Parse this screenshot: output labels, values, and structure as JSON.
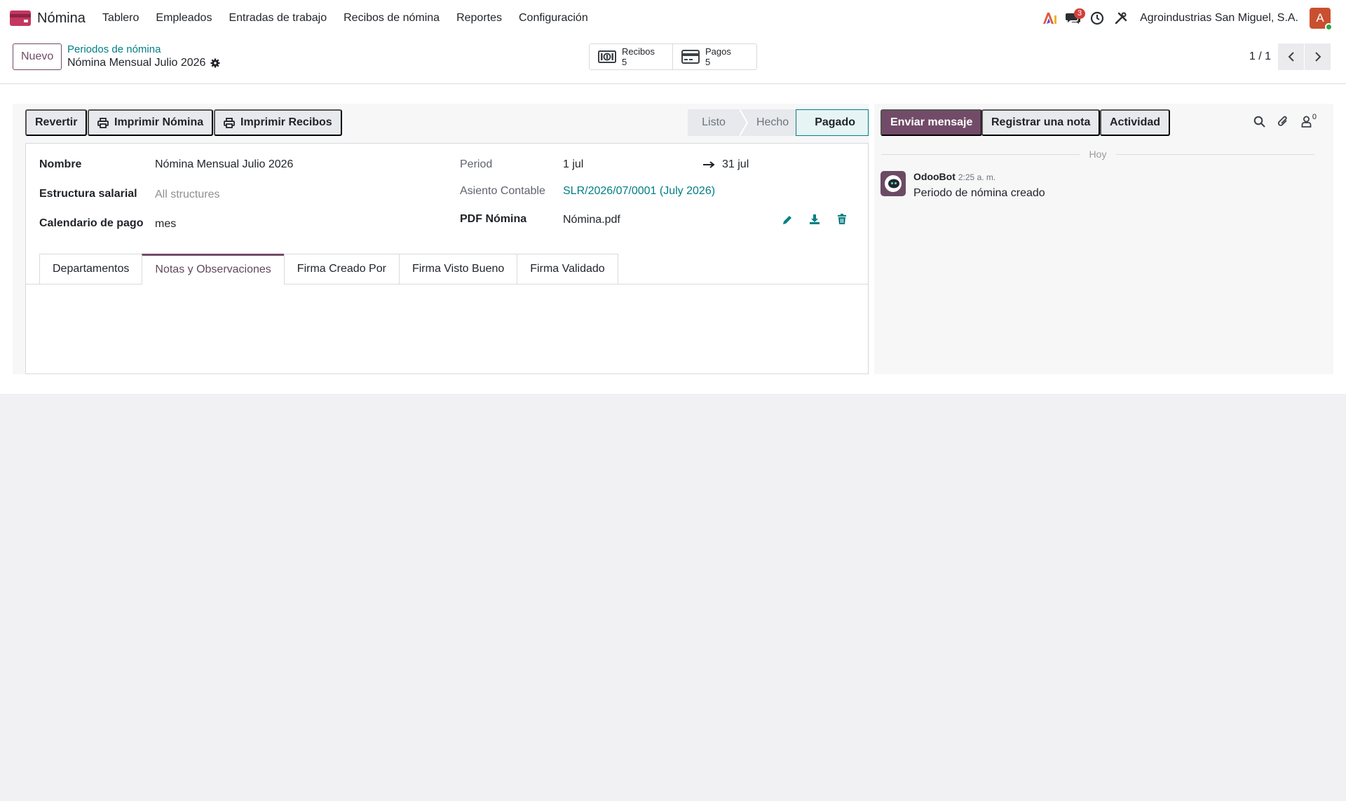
{
  "navbar": {
    "app_name": "Nómina",
    "menu": [
      "Tablero",
      "Empleados",
      "Entradas de trabajo",
      "Recibos de nómina",
      "Reportes",
      "Configuración"
    ],
    "chat_badge": "3",
    "company": "Agroindustrias San Miguel, S.A.",
    "avatar_letter": "A"
  },
  "control": {
    "new_label": "Nuevo",
    "breadcrumb_parent": "Periodos de nómina",
    "breadcrumb_current": "Nómina Mensual Julio 2026",
    "smart_buttons": [
      {
        "label": "Recibos",
        "count": "5"
      },
      {
        "label": "Pagos",
        "count": "5"
      }
    ],
    "pager": "1 / 1"
  },
  "actions": {
    "revert": "Revertir",
    "print_payroll": "Imprimir Nómina",
    "print_receipts": "Imprimir Recibos"
  },
  "stages": [
    "Listo",
    "Hecho",
    "Pagado"
  ],
  "active_stage": "Pagado",
  "form": {
    "name_label": "Nombre",
    "name_value": "Nómina Mensual Julio 2026",
    "structure_label": "Estructura salarial",
    "structure_value": "All structures",
    "calendar_label": "Calendario de pago",
    "calendar_value": "mes",
    "period_label": "Period",
    "period_start": "1 jul",
    "period_end": "31 jul",
    "entry_label": "Asiento Contable",
    "entry_value": "SLR/2026/07/0001 (July 2026)",
    "pdf_label": "PDF Nómina",
    "pdf_value": "Nómina.pdf"
  },
  "tabs": [
    "Departamentos",
    "Notas y Observaciones",
    "Firma Creado Por",
    "Firma Visto Bueno",
    "Firma Validado"
  ],
  "active_tab": "Notas y Observaciones",
  "chatter": {
    "send_message": "Enviar mensaje",
    "log_note": "Registrar una nota",
    "activity": "Actividad",
    "followers_count": "0",
    "day_separator": "Hoy",
    "message": {
      "author": "OdooBot",
      "time": "2:25 a. m.",
      "body": "Periodo de nómina creado"
    }
  },
  "colors": {
    "brand": "#714b67",
    "link": "#017e84",
    "badge": "#d23f3a"
  }
}
